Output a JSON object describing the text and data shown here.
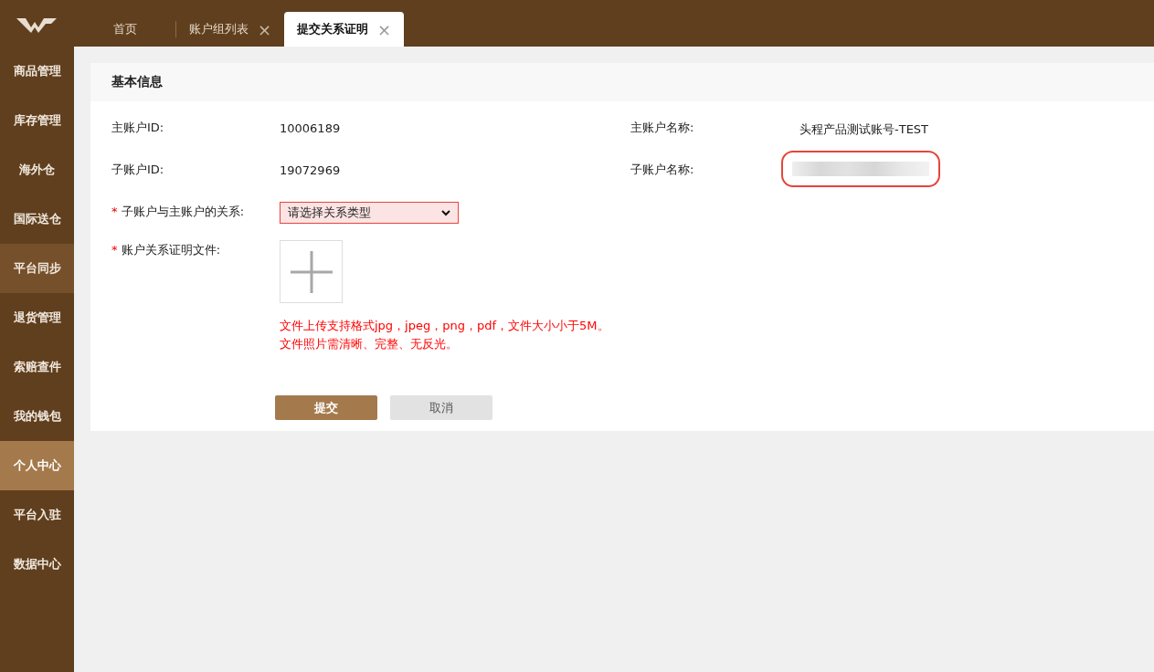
{
  "tabs": [
    {
      "label": "首页",
      "closable": false,
      "selected": false
    },
    {
      "label": "账户组列表",
      "closable": true,
      "selected": false
    },
    {
      "label": "提交关系证明",
      "closable": true,
      "selected": true
    }
  ],
  "tab_close_glyph": "×",
  "sidebar": {
    "items": [
      {
        "label": "商品管理",
        "selected": false,
        "hovered": false
      },
      {
        "label": "库存管理",
        "selected": false,
        "hovered": false
      },
      {
        "label": "海外仓",
        "selected": false,
        "hovered": false
      },
      {
        "label": "国际送仓",
        "selected": false,
        "hovered": false
      },
      {
        "label": "平台同步",
        "selected": false,
        "hovered": true
      },
      {
        "label": "退货管理",
        "selected": false,
        "hovered": false
      },
      {
        "label": "索赔查件",
        "selected": false,
        "hovered": false
      },
      {
        "label": "我的钱包",
        "selected": false,
        "hovered": false
      },
      {
        "label": "个人中心",
        "selected": true,
        "hovered": false
      },
      {
        "label": "平台入驻",
        "selected": false,
        "hovered": false
      },
      {
        "label": "数据中心",
        "selected": false,
        "hovered": false
      }
    ]
  },
  "panel": {
    "title": "基本信息",
    "info": [
      {
        "label": "主账户ID:",
        "value": "10006189",
        "redacted": false
      },
      {
        "label": "主账户名称:",
        "value": "头程产品测试账号-TEST",
        "redacted": false
      },
      {
        "label": "子账户ID:",
        "value": "19072969",
        "redacted": false
      },
      {
        "label": "子账户名称:",
        "redacted": true
      }
    ],
    "relation": {
      "required_mark": "*",
      "label": "子账户与主账户的关系:",
      "placeholder": "请选择关系类型",
      "invalid": true
    },
    "proof": {
      "required_mark": "*",
      "label": "账户关系证明文件:",
      "hints": [
        "文件上传支持格式jpg，jpeg，png，pdf，文件大小小于5M。",
        "文件照片需清晰、完整、无反光。"
      ]
    },
    "buttons": [
      {
        "label": "提交",
        "kind": "primary"
      },
      {
        "label": "取消",
        "kind": "secondary"
      }
    ]
  }
}
